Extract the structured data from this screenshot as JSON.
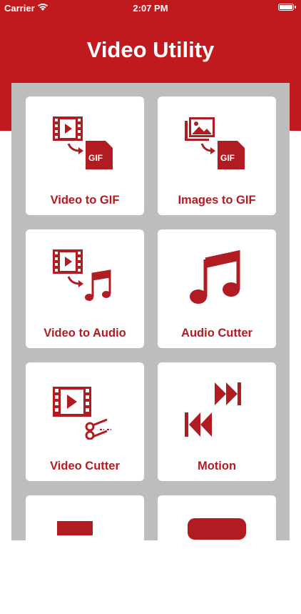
{
  "status_bar": {
    "carrier": "Carrier",
    "time": "2:07 PM"
  },
  "header": {
    "title": "Video Utility"
  },
  "tools": [
    {
      "label": "Video to GIF",
      "icon": "video-to-gif-icon"
    },
    {
      "label": "Images to GIF",
      "icon": "images-to-gif-icon"
    },
    {
      "label": "Video to Audio",
      "icon": "video-to-audio-icon"
    },
    {
      "label": "Audio Cutter",
      "icon": "music-note-icon"
    },
    {
      "label": "Video Cutter",
      "icon": "video-cutter-icon"
    },
    {
      "label": "Motion",
      "icon": "motion-icon"
    }
  ],
  "colors": {
    "brand": "#c01a1f",
    "label": "#b01c22",
    "panel": "#bdbdbd"
  }
}
